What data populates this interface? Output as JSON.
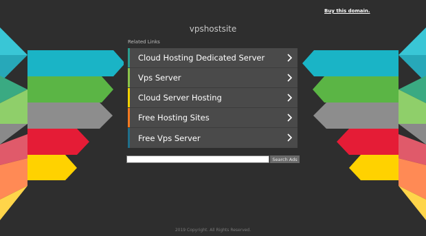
{
  "header": {
    "buy_link": "Buy this domain.",
    "domain": "vpshostsite"
  },
  "related": {
    "heading": "Related Links",
    "links": [
      {
        "label": "Cloud Hosting Dedicated Server",
        "accent": "#2a9d8f"
      },
      {
        "label": "Vps Server",
        "accent": "#8bc34a"
      },
      {
        "label": "Cloud Server Hosting",
        "accent": "#f2d200"
      },
      {
        "label": "Free Hosting Sites",
        "accent": "#f47a20"
      },
      {
        "label": "Free Vps Server",
        "accent": "#1f6f8b"
      }
    ]
  },
  "search": {
    "placeholder": "",
    "button_label": "Search Ads"
  },
  "footer": {
    "copyright": "2019 Copyright. All Rights Reserved."
  },
  "colors": {
    "background": "#2e2e2e",
    "panel": "#4a4a4a",
    "ribbon_cyan": "#18c3dd",
    "ribbon_green": "#5ab544",
    "ribbon_gray": "#8c8c8c",
    "ribbon_red": "#e4263c",
    "ribbon_yellow": "#ffd200"
  }
}
